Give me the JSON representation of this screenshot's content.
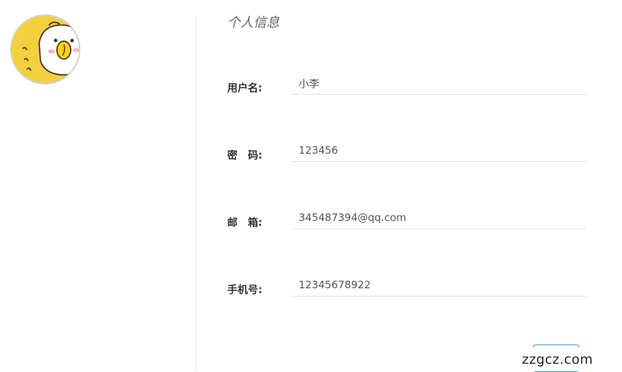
{
  "page": {
    "title": "个人信息"
  },
  "form": {
    "username": {
      "label": "用户名:",
      "value": "小李"
    },
    "password": {
      "label": "密　码:",
      "value": "123456"
    },
    "email": {
      "label": "邮　箱:",
      "value": "345487394@qq.com"
    },
    "phone": {
      "label": "手机号:",
      "value": "12345678922"
    }
  },
  "watermark": {
    "text": "zzgcz.com"
  },
  "colors": {
    "accent": "#2f8fe0",
    "avatar_bg": "#f4d03f",
    "divider": "#e4e4e4"
  }
}
